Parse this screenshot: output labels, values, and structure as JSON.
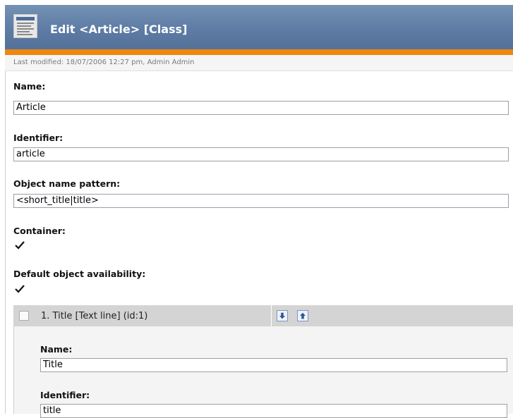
{
  "window": {
    "title": "Edit <Article> [Class]",
    "icon": "document-icon"
  },
  "last_modified": "Last modified: 18/07/2006 12:27 pm, Admin Admin",
  "form": {
    "name_label": "Name:",
    "name_value": "Article",
    "identifier_label": "Identifier:",
    "identifier_value": "article",
    "pattern_label": "Object name pattern:",
    "pattern_value": "<short_title|title>",
    "container_label": "Container:",
    "container_checked": true,
    "availability_label": "Default object availability:",
    "availability_checked": true
  },
  "attribute": {
    "title": "1. Title [Text line] (id:1)",
    "selected": false,
    "move_down_icon": "arrow-down-icon",
    "move_up_icon": "arrow-up-icon",
    "name_label": "Name:",
    "name_value": "Title",
    "identifier_label": "Identifier:",
    "identifier_value": "title"
  },
  "colors": {
    "titlebar": "#5c7aa3",
    "accent": "#ef8610",
    "attr_bar": "#d4d4d4"
  }
}
